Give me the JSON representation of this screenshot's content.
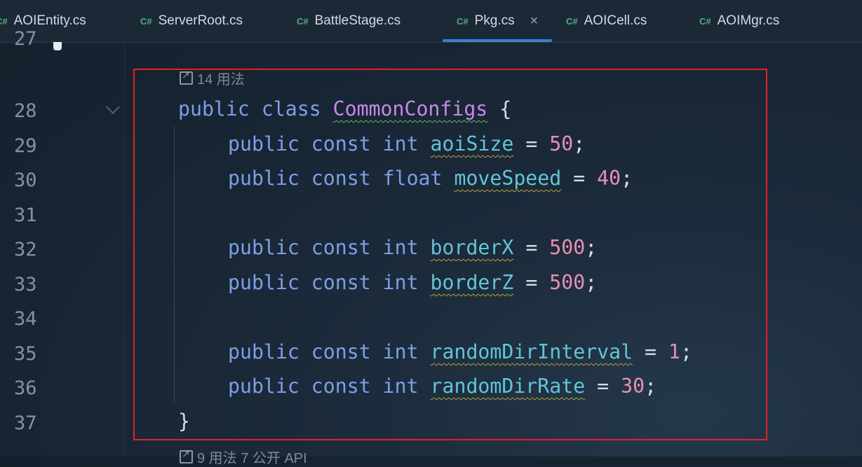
{
  "tabs": [
    {
      "lang": "C#",
      "label": "AOIEntity.cs",
      "active": false
    },
    {
      "lang": "C#",
      "label": "ServerRoot.cs",
      "active": false
    },
    {
      "lang": "C#",
      "label": "BattleStage.cs",
      "active": false
    },
    {
      "lang": "C#",
      "label": "Pkg.cs",
      "active": true,
      "close": "×"
    },
    {
      "lang": "C#",
      "label": "AOICell.cs",
      "active": false
    },
    {
      "lang": "C#",
      "label": "AOIMgr.cs",
      "active": false
    }
  ],
  "line_numbers": [
    "27",
    "28",
    "29",
    "30",
    "31",
    "32",
    "33",
    "34",
    "35",
    "36",
    "37"
  ],
  "usage_top": "14 用法",
  "usage_bottom": "9 用法   7 公开 API",
  "code": {
    "class_decl": {
      "kw1": "public",
      "kw2": "class",
      "name": "CommonConfigs",
      "brace": "{"
    },
    "fields": [
      {
        "mods": "public const",
        "type": "int",
        "name": "aoiSize",
        "value": "50"
      },
      {
        "mods": "public const",
        "type": "float",
        "name": "moveSpeed",
        "value": "40"
      },
      {
        "mods": "public const",
        "type": "int",
        "name": "borderX",
        "value": "500"
      },
      {
        "mods": "public const",
        "type": "int",
        "name": "borderZ",
        "value": "500"
      },
      {
        "mods": "public const",
        "type": "int",
        "name": "randomDirInterval",
        "value": "1"
      },
      {
        "mods": "public const",
        "type": "int",
        "name": "randomDirRate",
        "value": "30"
      }
    ],
    "close_brace": "}"
  },
  "colors": {
    "keyword": "#7d9fe8",
    "class_name": "#c789e8",
    "field": "#62c4d8",
    "number": "#e88fb2",
    "highlight_box": "#e1212b",
    "active_tab_underline": "#3f7fd6"
  }
}
